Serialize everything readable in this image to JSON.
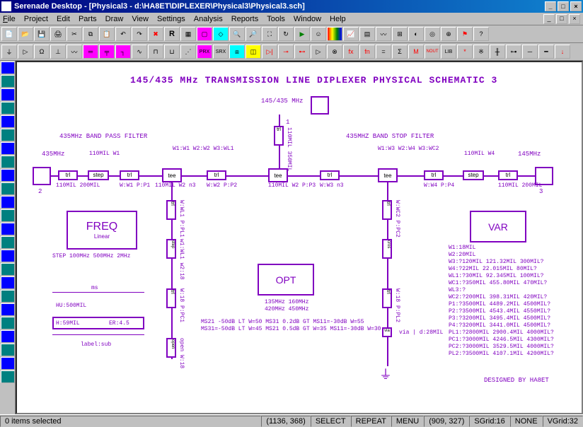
{
  "window": {
    "title": "Serenade Desktop - [Physical3 - d:\\HA8ET\\DIPLEXER\\Physical3\\Physical3.sch]"
  },
  "menu": {
    "file": "File",
    "project": "Project",
    "edit": "Edit",
    "parts": "Parts",
    "draw": "Draw",
    "view": "View",
    "settings": "Settings",
    "analysis": "Analysis",
    "reports": "Reports",
    "tools": "Tools",
    "window": "Window",
    "help": "Help"
  },
  "schematic": {
    "title": "145/435 MHz TRANSMISSION LINE DIPLEXER PHYSICAL SCHEMATIC 3",
    "port_top": "145/435 MHz",
    "port_top_num": "1",
    "port_left": "435MHz",
    "port_left_num": "2",
    "port_right": "145MHz",
    "port_right_num": "3",
    "bandpass_label": "435MHz BAND PASS FILTER",
    "bandstop_label": "435MHZ BAND STOP FILTER",
    "trl1": {
      "type": "trl",
      "vals": "110MIL\n200MIL"
    },
    "step1": {
      "type": "step",
      "label": "110MIL\nW1"
    },
    "trl2": {
      "type": "trl",
      "label": "W1:W1\nW2:W2\nW3:WL1",
      "vals": "W:W1\nP:P1"
    },
    "tee1": {
      "type": "tee"
    },
    "teevals1": "110MIL\nW2\nn3",
    "trl_mid1": {
      "type": "trl",
      "vals": "W:W2\nP:P2"
    },
    "tee_mid": {
      "type": "tee",
      "top": "110MIL\n350MIL"
    },
    "tee_mid_vals": "110MIL\nW2\nP:P3",
    "trl_mid2": {
      "type": "trl",
      "vals": "W:W3\nn3"
    },
    "tee2": {
      "type": "tee",
      "label": "W1:W3\nW2:W4\nW3:WC2"
    },
    "tee2_vals": "",
    "trl3": {
      "type": "trl",
      "vals": "W:W4\nP:P4"
    },
    "step2": {
      "type": "step",
      "label": "110MIL\nW4"
    },
    "trl4": {
      "type": "trl",
      "vals": "110MIL\n200MIL"
    },
    "left_stub": {
      "trl_a": "W:WL1\nP:PL1",
      "step": "w1:WL1\nw2:18",
      "trl_b": "W:18\nP:PC1",
      "open": "open\nW:18"
    },
    "right_stub": {
      "trl_a": "W:WC2\nP:PC2",
      "cros": "cros",
      "trl_b": "W:18\nP:PL2",
      "via": "via | d:28MIL",
      "trl_c": "W:18\nP:PL2"
    },
    "freq_block": {
      "title": "FREQ",
      "sub": "Linear",
      "note": "STEP 100MHz 500MHz 2MHz"
    },
    "opt_block": {
      "title": "OPT",
      "line1": "135MHz 160MHz",
      "line2": "420MHz 450MHz",
      "opt1": "MS21 -50dB LT W=50  MS31 0.2dB GT  MS11=-30dB W=55",
      "opt2": "MS31=-50dB LT W=45 MS21 0.5dB GT W=35 MS11=-30dB W=30"
    },
    "var_block": {
      "title": "VAR",
      "lines": [
        "W1:18MIL",
        "W2:20MIL",
        "W3:?120MIL 121.32MIL 300MIL?",
        "W4:?22MIL 22.015MIL  80MIL?",
        "WL1:?30MIL 92.345MIL 100MIL?",
        "WC1:?350MIL 455.80MIL 470MIL?",
        "WL3:?",
        "WC2:?200MIL 398.31MIL 420MIL?",
        "P1:?3500MIL 4489.2MIL 4500MIL?",
        "P2:?3500MIL 4543.4MIL 4550MIL?",
        "P3:?3200MIL 3495.4MIL 4500MIL?",
        "P4:?3200MIL 3441.0MIL 4500MIL?",
        "PL1:?2800MIL 2900.4MIL 4000MIL?",
        "PC1:?3000MIL 4246.5MIL 4300MIL?",
        "PC2:?3000MIL 3529.5MIL 4000MIL?",
        "PL2:?3500MIL 4107.1MIL  4200MIL?"
      ]
    },
    "substrate": {
      "ms": "ms",
      "hu": "HU:500MIL",
      "h": "H:59MIL",
      "er": "ER:4.5",
      "label": "label:sub"
    },
    "credit": "DESIGNED BY HA8ET"
  },
  "status": {
    "items_selected": "0 items selected",
    "coords1": "(1136, 368)",
    "select": "SELECT",
    "repeat": "REPEAT",
    "menu": "MENU",
    "coords2": "(909, 327)",
    "sgrid": "SGrid:16",
    "none": "NONE",
    "vgrid": "VGrid:32"
  }
}
